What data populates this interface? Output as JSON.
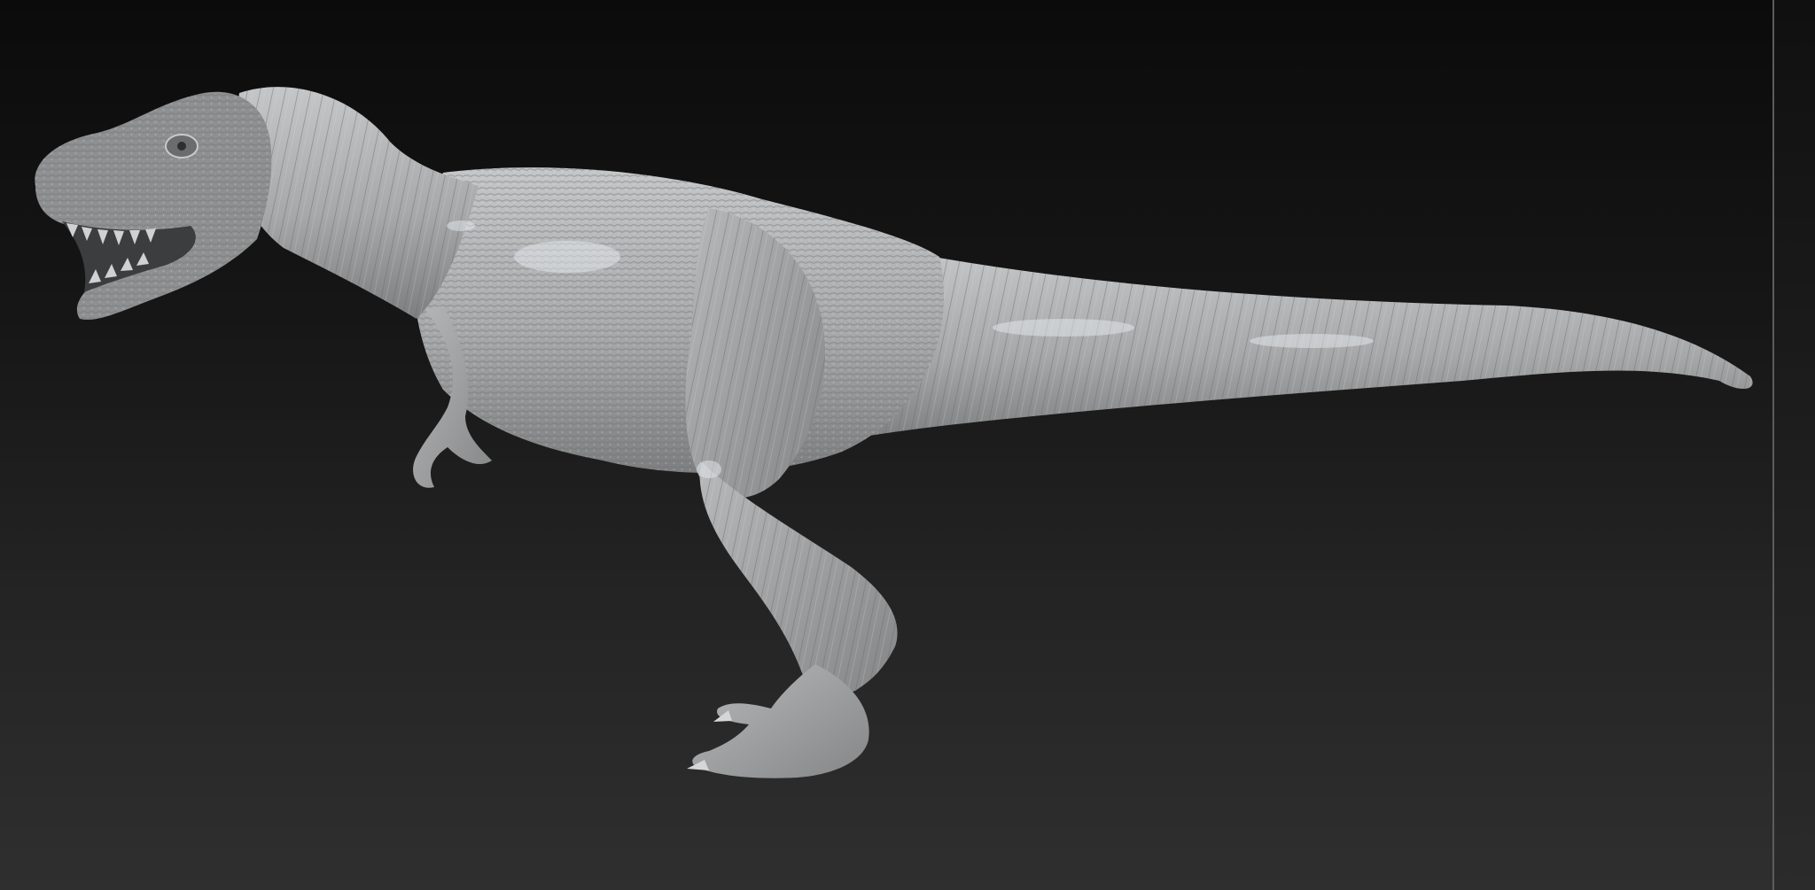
{
  "viewport": {
    "background_top": "#0b0b0b",
    "background_bottom": "#2f2f2f",
    "model": {
      "subject": "tyrannosaurus-rex",
      "material_color": "#a9a9a9",
      "highlight_color": "#d8dde2",
      "shadow_color": "#5a5a5a"
    }
  },
  "rail": {
    "divider_color": "#5c5c5c"
  }
}
